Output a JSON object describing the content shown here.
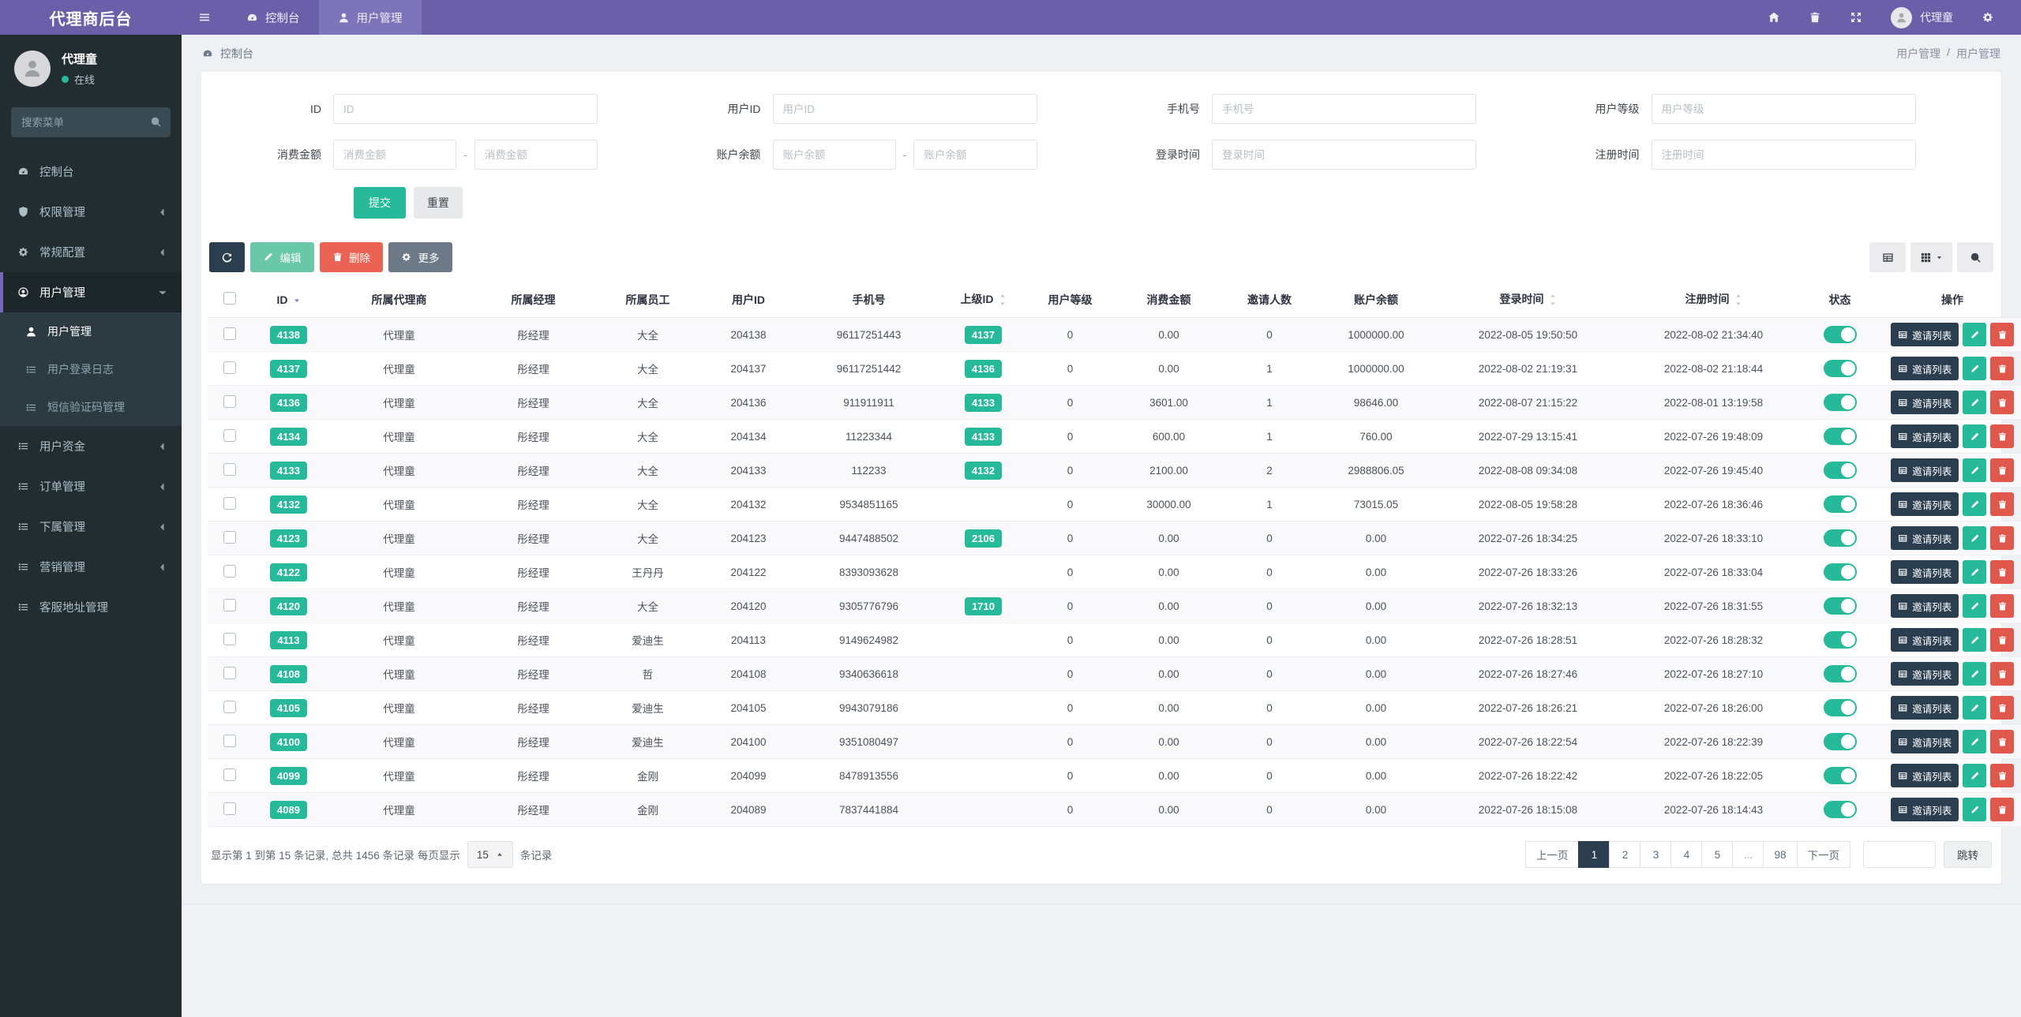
{
  "colors": {
    "purple": "#6b5fa9",
    "green": "#26b99a",
    "dark": "#2b3e50",
    "red": "#ea6354"
  },
  "topbar": {
    "brand": "代理商后台",
    "tabs": [
      {
        "name": "dashboard",
        "icon": "gauge",
        "label": "控制台",
        "active": false
      },
      {
        "name": "user-management",
        "icon": "user",
        "label": "用户管理",
        "active": true
      }
    ],
    "user_name": "代理童"
  },
  "sidebar": {
    "user_name": "代理童",
    "status": "在线",
    "search_placeholder": "搜索菜单",
    "menu": [
      {
        "name": "dashboard",
        "icon": "gauge",
        "label": "控制台"
      },
      {
        "name": "permission-management",
        "icon": "shield",
        "label": "权限管理",
        "chevron": "left"
      },
      {
        "name": "general-config",
        "icon": "gear",
        "label": "常规配置",
        "chevron": "left"
      },
      {
        "name": "user-management",
        "icon": "user-circle",
        "label": "用户管理",
        "chevron": "down",
        "active": true,
        "children": [
          {
            "name": "user-management",
            "icon": "user",
            "label": "用户管理",
            "active": true
          },
          {
            "name": "user-login-log",
            "icon": "list",
            "label": "用户登录日志"
          },
          {
            "name": "sms-code-management",
            "icon": "list",
            "label": "短信验证码管理"
          }
        ]
      },
      {
        "name": "user-funds",
        "icon": "list",
        "label": "用户资金",
        "chevron": "left"
      },
      {
        "name": "order-management",
        "icon": "list",
        "label": "订单管理",
        "chevron": "left"
      },
      {
        "name": "subordinate-management",
        "icon": "list",
        "label": "下属管理",
        "chevron": "left"
      },
      {
        "name": "marketing-management",
        "icon": "list",
        "label": "营销管理",
        "chevron": "left"
      },
      {
        "name": "customer-service-address",
        "icon": "list",
        "label": "客服地址管理"
      }
    ]
  },
  "breadcrumb": {
    "left": "控制台",
    "trail_1": "用户管理",
    "separator": "/",
    "trail_2": "用户管理"
  },
  "filters": {
    "submit_label": "提交",
    "reset_label": "重置",
    "fields": [
      {
        "name": "id",
        "label": "ID",
        "placeholder": "ID"
      },
      {
        "name": "user-id",
        "label": "用户ID",
        "placeholder": "用户ID"
      },
      {
        "name": "phone",
        "label": "手机号",
        "placeholder": "手机号"
      },
      {
        "name": "user-level",
        "label": "用户等级",
        "placeholder": "用户等级"
      },
      {
        "name": "consume-amount",
        "label": "消费金额",
        "placeholder": "消费金额",
        "range": true
      },
      {
        "name": "account-balance",
        "label": "账户余额",
        "placeholder": "账户余额",
        "range": true
      },
      {
        "name": "login-time",
        "label": "登录时间",
        "placeholder": "登录时间"
      },
      {
        "name": "register-time",
        "label": "注册时间",
        "placeholder": "注册时间"
      }
    ]
  },
  "toolbar": {
    "edit_label": "编辑",
    "delete_label": "删除",
    "more_label": "更多"
  },
  "table": {
    "invite_label": "邀请列表",
    "columns": [
      {
        "label": "ID",
        "sort": "desc"
      },
      {
        "label": "所属代理商"
      },
      {
        "label": "所属经理"
      },
      {
        "label": "所属员工"
      },
      {
        "label": "用户ID"
      },
      {
        "label": "手机号"
      },
      {
        "label": "上级ID",
        "sort": "both"
      },
      {
        "label": "用户等级"
      },
      {
        "label": "消费金额"
      },
      {
        "label": "邀请人数"
      },
      {
        "label": "账户余额"
      },
      {
        "label": "登录时间",
        "sort": "both"
      },
      {
        "label": "注册时间",
        "sort": "both"
      },
      {
        "label": "状态"
      },
      {
        "label": "操作"
      }
    ],
    "rows": [
      {
        "id": "4138",
        "agent": "代理童",
        "manager": "彤经理",
        "staff": "大全",
        "user_id": "204138",
        "phone": "96117251443",
        "parent_id": "4137",
        "level": "0",
        "consume": "0.00",
        "invites": "0",
        "balance": "1000000.00",
        "login_time": "2022-08-05 19:50:50",
        "reg_time": "2022-08-02 21:34:40",
        "status": true
      },
      {
        "id": "4137",
        "agent": "代理童",
        "manager": "彤经理",
        "staff": "大全",
        "user_id": "204137",
        "phone": "96117251442",
        "parent_id": "4136",
        "level": "0",
        "consume": "0.00",
        "invites": "1",
        "balance": "1000000.00",
        "login_time": "2022-08-02 21:19:31",
        "reg_time": "2022-08-02 21:18:44",
        "status": true
      },
      {
        "id": "4136",
        "agent": "代理童",
        "manager": "彤经理",
        "staff": "大全",
        "user_id": "204136",
        "phone": "911911911",
        "parent_id": "4133",
        "level": "0",
        "consume": "3601.00",
        "invites": "1",
        "balance": "98646.00",
        "login_time": "2022-08-07 21:15:22",
        "reg_time": "2022-08-01 13:19:58",
        "status": true
      },
      {
        "id": "4134",
        "agent": "代理童",
        "manager": "彤经理",
        "staff": "大全",
        "user_id": "204134",
        "phone": "11223344",
        "parent_id": "4133",
        "level": "0",
        "consume": "600.00",
        "invites": "1",
        "balance": "760.00",
        "login_time": "2022-07-29 13:15:41",
        "reg_time": "2022-07-26 19:48:09",
        "status": true
      },
      {
        "id": "4133",
        "agent": "代理童",
        "manager": "彤经理",
        "staff": "大全",
        "user_id": "204133",
        "phone": "112233",
        "parent_id": "4132",
        "level": "0",
        "consume": "2100.00",
        "invites": "2",
        "balance": "2988806.05",
        "login_time": "2022-08-08 09:34:08",
        "reg_time": "2022-07-26 19:45:40",
        "status": true
      },
      {
        "id": "4132",
        "agent": "代理童",
        "manager": "彤经理",
        "staff": "大全",
        "user_id": "204132",
        "phone": "9534851165",
        "parent_id": "",
        "level": "0",
        "consume": "30000.00",
        "invites": "1",
        "balance": "73015.05",
        "login_time": "2022-08-05 19:58:28",
        "reg_time": "2022-07-26 18:36:46",
        "status": true
      },
      {
        "id": "4123",
        "agent": "代理童",
        "manager": "彤经理",
        "staff": "大全",
        "user_id": "204123",
        "phone": "9447488502",
        "parent_id": "2106",
        "level": "0",
        "consume": "0.00",
        "invites": "0",
        "balance": "0.00",
        "login_time": "2022-07-26 18:34:25",
        "reg_time": "2022-07-26 18:33:10",
        "status": true
      },
      {
        "id": "4122",
        "agent": "代理童",
        "manager": "彤经理",
        "staff": "王丹丹",
        "user_id": "204122",
        "phone": "8393093628",
        "parent_id": "",
        "level": "0",
        "consume": "0.00",
        "invites": "0",
        "balance": "0.00",
        "login_time": "2022-07-26 18:33:26",
        "reg_time": "2022-07-26 18:33:04",
        "status": true
      },
      {
        "id": "4120",
        "agent": "代理童",
        "manager": "彤经理",
        "staff": "大全",
        "user_id": "204120",
        "phone": "9305776796",
        "parent_id": "1710",
        "level": "0",
        "consume": "0.00",
        "invites": "0",
        "balance": "0.00",
        "login_time": "2022-07-26 18:32:13",
        "reg_time": "2022-07-26 18:31:55",
        "status": true
      },
      {
        "id": "4113",
        "agent": "代理童",
        "manager": "彤经理",
        "staff": "爱迪生",
        "user_id": "204113",
        "phone": "9149624982",
        "parent_id": "",
        "level": "0",
        "consume": "0.00",
        "invites": "0",
        "balance": "0.00",
        "login_time": "2022-07-26 18:28:51",
        "reg_time": "2022-07-26 18:28:32",
        "status": true
      },
      {
        "id": "4108",
        "agent": "代理童",
        "manager": "彤经理",
        "staff": "哲",
        "user_id": "204108",
        "phone": "9340636618",
        "parent_id": "",
        "level": "0",
        "consume": "0.00",
        "invites": "0",
        "balance": "0.00",
        "login_time": "2022-07-26 18:27:46",
        "reg_time": "2022-07-26 18:27:10",
        "status": true
      },
      {
        "id": "4105",
        "agent": "代理童",
        "manager": "彤经理",
        "staff": "爱迪生",
        "user_id": "204105",
        "phone": "9943079186",
        "parent_id": "",
        "level": "0",
        "consume": "0.00",
        "invites": "0",
        "balance": "0.00",
        "login_time": "2022-07-26 18:26:21",
        "reg_time": "2022-07-26 18:26:00",
        "status": true
      },
      {
        "id": "4100",
        "agent": "代理童",
        "manager": "彤经理",
        "staff": "爱迪生",
        "user_id": "204100",
        "phone": "9351080497",
        "parent_id": "",
        "level": "0",
        "consume": "0.00",
        "invites": "0",
        "balance": "0.00",
        "login_time": "2022-07-26 18:22:54",
        "reg_time": "2022-07-26 18:22:39",
        "status": true
      },
      {
        "id": "4099",
        "agent": "代理童",
        "manager": "彤经理",
        "staff": "金刚",
        "user_id": "204099",
        "phone": "8478913556",
        "parent_id": "",
        "level": "0",
        "consume": "0.00",
        "invites": "0",
        "balance": "0.00",
        "login_time": "2022-07-26 18:22:42",
        "reg_time": "2022-07-26 18:22:05",
        "status": true
      },
      {
        "id": "4089",
        "agent": "代理童",
        "manager": "彤经理",
        "staff": "金刚",
        "user_id": "204089",
        "phone": "7837441884",
        "parent_id": "",
        "level": "0",
        "consume": "0.00",
        "invites": "0",
        "balance": "0.00",
        "login_time": "2022-07-26 18:15:08",
        "reg_time": "2022-07-26 18:14:43",
        "status": true
      }
    ]
  },
  "pagination": {
    "summary_prefix": "显示第 1 到第 15 条记录, 总共 1456 条记录 每页显示",
    "page_size": "15",
    "summary_suffix": "条记录",
    "prev_label": "上一页",
    "pages": [
      "1",
      "2",
      "3",
      "4",
      "5",
      "...",
      "98"
    ],
    "active_page": "1",
    "next_label": "下一页",
    "jump_label": "跳转"
  }
}
